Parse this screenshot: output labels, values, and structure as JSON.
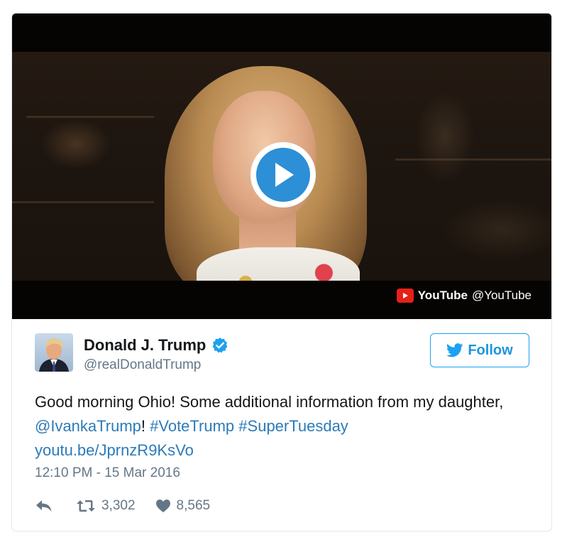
{
  "video": {
    "provider_name": "YouTube",
    "provider_handle": "@YouTube"
  },
  "author": {
    "display_name": "Donald J. Trump",
    "handle": "@realDonaldTrump"
  },
  "follow_button": {
    "label": "Follow"
  },
  "tweet": {
    "text_part1": "Good morning Ohio! Some additional information from my daughter, ",
    "mention": "@IvankaTrump",
    "text_part2": "! ",
    "hashtag1": "#VoteTrump",
    "space": " ",
    "hashtag2": "#SuperTuesday",
    "link": "youtu.be/JprnzR9KsVo"
  },
  "timestamp": "12:10 PM - 15 Mar 2016",
  "actions": {
    "retweets": "3,302",
    "likes": "8,565"
  },
  "icons": {
    "play": "play-icon",
    "youtube": "youtube-logo-icon",
    "verified": "verified-badge-icon",
    "twitter": "twitter-bird-icon",
    "reply": "reply-icon",
    "retweet": "retweet-icon",
    "like": "heart-icon"
  },
  "colors": {
    "twitter_blue": "#1da1f2",
    "link_blue": "#2b7bb9",
    "play_blue": "#2d8fd5",
    "youtube_red": "#e62117",
    "meta_gray": "#657786"
  }
}
